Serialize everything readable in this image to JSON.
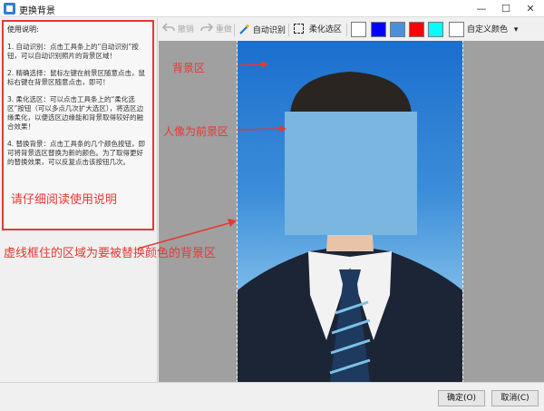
{
  "window": {
    "title": "更换背景",
    "icons": {
      "app": "app-icon",
      "minimize": "minimize-icon",
      "maximize": "maximize-icon",
      "close": "close-icon"
    },
    "minimize_glyph": "—",
    "maximize_glyph": "☐",
    "close_glyph": "✕"
  },
  "instructions": {
    "title": "使用说明:",
    "items": [
      "1. 自动识别：点击工具条上的“自动识别”按钮，可以自动识别照片的背景区域！",
      "2. 精确选择：鼠标左键在前景区随意点击，鼠标右键在背景区随意点击，即可！",
      "3. 柔化选区：可以点击工具条上的“柔化选区”按钮（可以多点几次扩大选区），将选区边缘柔化，以便选区边缘能和背景取得较好的融合效果！",
      "4. 替换背景：点击工具条的几个颜色按钮，即可将背景选区替换为新的颜色。为了取得更好的替换效果，可以反复点击该按钮几次。"
    ],
    "warning": "请仔细阅读使用说明"
  },
  "toolbar": {
    "undo": "撤销",
    "redo": "重做",
    "auto_detect": "自动识别",
    "soften": "柔化选区",
    "custom_color": "自定义颜色",
    "icons": {
      "undo": "undo-icon",
      "redo": "redo-icon",
      "auto_detect": "magic-wand-icon",
      "soften": "dashed-selection-icon",
      "dropdown": "chevron-down-icon"
    },
    "swatches": [
      "#ffffff",
      "#0000ff",
      "#4a90d9",
      "#ff0000",
      "#00ffff"
    ],
    "custom_swatch": "#ffffff",
    "dropdown_glyph": "▾"
  },
  "annotations": {
    "background": "背景区",
    "foreground": "人像为前景区",
    "dashed_area": "虚线框住的区域为要被替换颜色的背景区"
  },
  "footer": {
    "ok": "确定(O)",
    "cancel": "取消(C)"
  },
  "colors": {
    "annotation_red": "#e53935",
    "photo_background": "#3c8ed9",
    "face_mask": "#7ab6e0",
    "suit": "#1c2535",
    "shirt": "#f2f2f2",
    "tie": "#1e3a5f",
    "tie_stripe": "#7ec1e8"
  }
}
